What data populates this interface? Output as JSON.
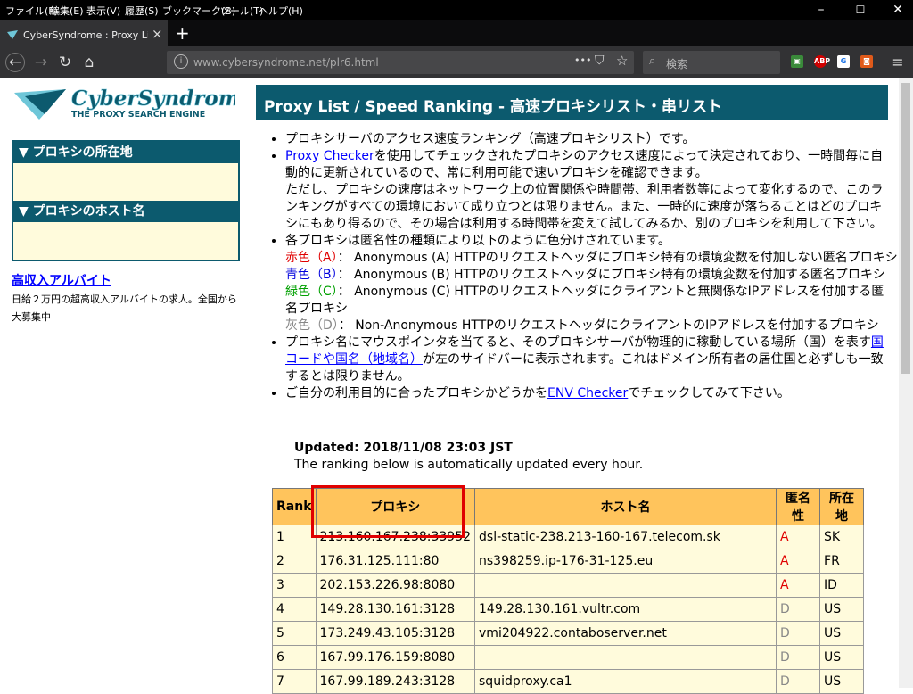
{
  "menubar": {
    "items": [
      "ファイル(F)",
      "編集(E)",
      "表示(V)",
      "履歴(S)",
      "ブックマーク(B)",
      "ツール(T)",
      "ヘルプ(H)"
    ]
  },
  "tab": {
    "title": "CyberSyndrome : Proxy List / S|",
    "close": "×",
    "new": "+"
  },
  "navbar": {
    "url": "www.cybersyndrome.net/plr6.html",
    "search_placeholder": "検索",
    "more": "•••"
  },
  "sidebar": {
    "logo": {
      "line1": "CyberSyndrome",
      "line2": "THE PROXY SEARCH ENGINE"
    },
    "panel1_title": "▼ プロキシの所在地",
    "panel2_title": "▼ プロキシのホスト名",
    "ad_link": "高収入アルバイト",
    "ad_text": "日給２万円の超高収入アルバイトの求人。全国から大募集中"
  },
  "main": {
    "title": "Proxy List / Speed Ranking - 高速プロキシリスト・串リスト",
    "b1": "プロキシサーバのアクセス速度ランキング（高速プロキシリスト）です。",
    "b2_link": "Proxy Checker",
    "b2_text": "を使用してチェックされたプロキシのアクセス速度によって決定されており、一時間毎に自動的に更新されているので、常に利用可能で速いプロキシを確認できます。",
    "b2_text2": "ただし、プロキシの速度はネットワーク上の位置関係や時間帯、利用者数等によって変化するので、このランキングがすべての環境において成り立つとは限りません。また、一時的に速度が落ちることはどのプロキシにもあり得るので、その場合は利用する時間帯を変えて試してみるか、別のプロキシを利用して下さい。",
    "b3": "各プロキシは匿名性の種類により以下のように色分けされています。",
    "legend": [
      {
        "label": "赤色（A）",
        "desc": "：  Anonymous (A)    HTTPのリクエストヘッダにプロキシ特有の環境変数を付加しない匿名プロキシ",
        "color": "#e00000"
      },
      {
        "label": "青色（B）",
        "desc": "：  Anonymous (B)    HTTPのリクエストヘッダにプロキシ特有の環境変数を付加する匿名プロキシ",
        "color": "#0000dd"
      },
      {
        "label": "緑色（C）",
        "desc": "：  Anonymous (C)    HTTPのリクエストヘッダにクライアントと無関係なIPアドレスを付加する匿名プロキシ",
        "color": "#00a000"
      },
      {
        "label": "灰色（D）",
        "desc": "：  Non-Anonymous    HTTPのリクエストヘッダにクライアントのIPアドレスを付加するプロキシ",
        "color": "#888888"
      }
    ],
    "b4_text1": "プロキシ名にマウスポインタを当てると、そのプロキシサーバが物理的に稼動している場所（国）を表す",
    "b4_link": "国コードや国名（地域名）",
    "b4_text2": "が左のサイドバーに表示されます。これはドメイン所有者の居住国と必ずしも一致するとは限りません。",
    "b5_text1": "ご自分の利用目的に合ったプロキシかどうかを",
    "b5_link": "ENV Checker",
    "b5_text2": "でチェックしてみて下さい。",
    "updated": "Updated: 2018/11/08 23:03 JST",
    "updated_note": "The ranking below is automatically updated every hour."
  },
  "table": {
    "headers": [
      "Rank",
      "プロキシ",
      "ホスト名",
      "匿名性",
      "所在地"
    ],
    "rows": [
      [
        "1",
        "213.160.167.238:33952",
        "dsl-static-238.213-160-167.telecom.sk",
        "A",
        "SK"
      ],
      [
        "2",
        "176.31.125.111:80",
        "ns398259.ip-176-31-125.eu",
        "A",
        "FR"
      ],
      [
        "3",
        "202.153.226.98:8080",
        "",
        "A",
        "ID"
      ],
      [
        "4",
        "149.28.130.161:3128",
        "149.28.130.161.vultr.com",
        "D",
        "US"
      ],
      [
        "5",
        "173.249.43.105:3128",
        "vmi204922.contaboserver.net",
        "D",
        "US"
      ],
      [
        "6",
        "167.99.176.159:8080",
        "",
        "D",
        "US"
      ],
      [
        "7",
        "167.99.189.243:3128",
        "squidproxy.ca1",
        "D",
        "US"
      ]
    ]
  }
}
